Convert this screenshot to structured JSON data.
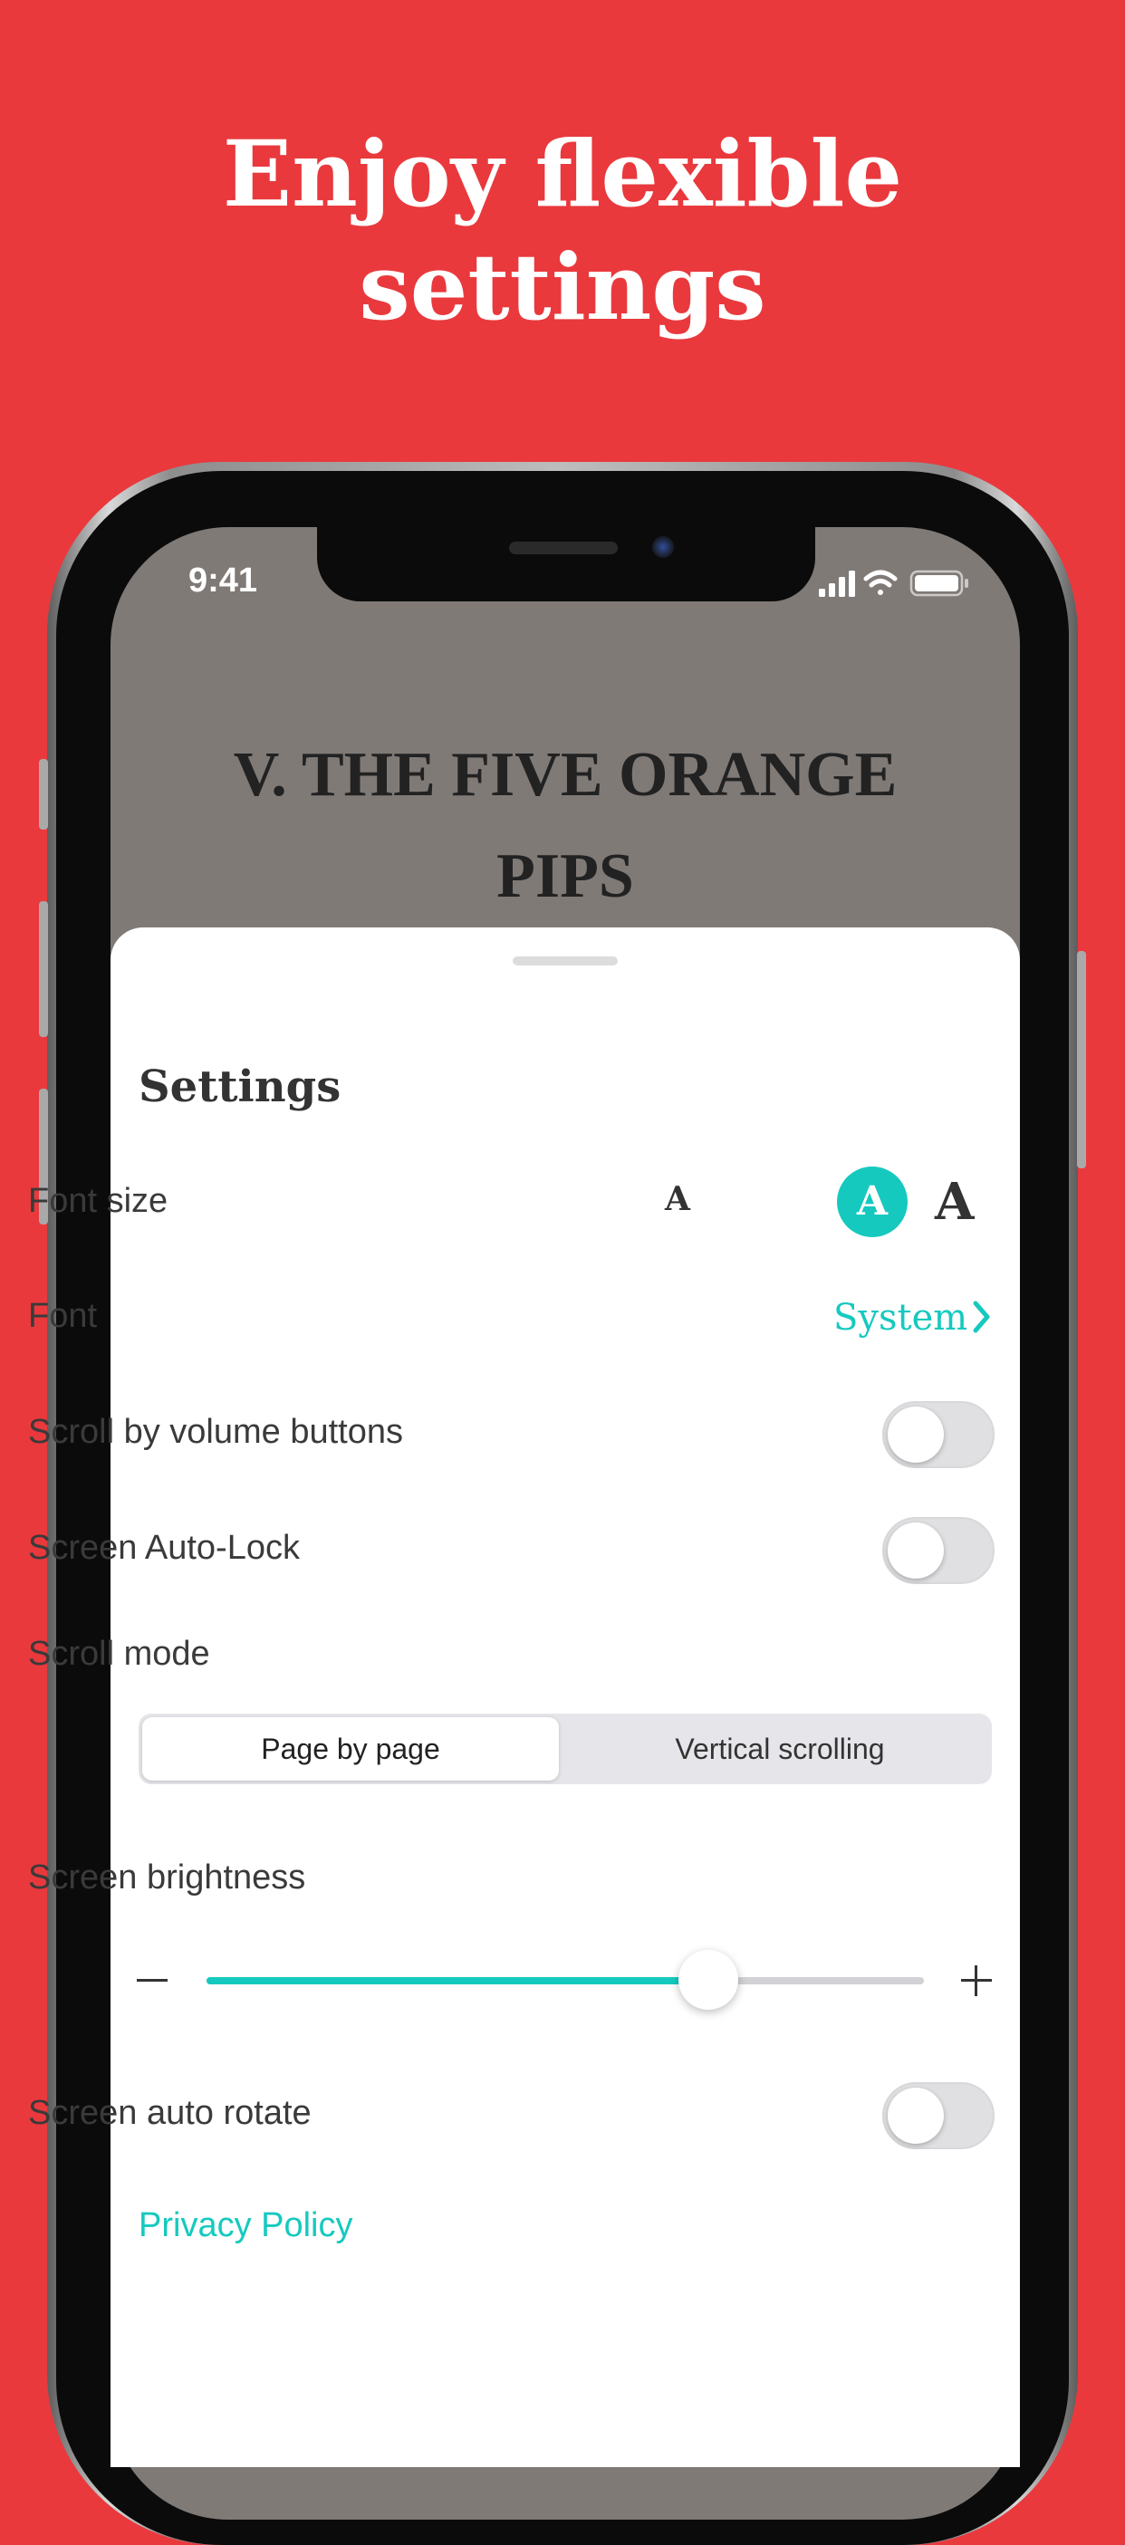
{
  "promo": {
    "headline_line1": "Enjoy flexible",
    "headline_line2": "settings"
  },
  "status_bar": {
    "time": "9:41",
    "icons": [
      "signal-icon",
      "wifi-icon",
      "battery-icon"
    ]
  },
  "book": {
    "title_line1": "V. THE FIVE ORANGE",
    "title_line2": "PIPS"
  },
  "settings": {
    "title": "Settings",
    "font_size": {
      "label": "Font size",
      "options": [
        "A",
        "A",
        "A"
      ],
      "selected_index": 1
    },
    "font": {
      "label": "Font",
      "value": "System"
    },
    "scroll_by_volume": {
      "label": "Scroll by volume buttons",
      "on": false
    },
    "auto_lock": {
      "label": "Screen Auto-Lock",
      "on": false
    },
    "scroll_mode": {
      "label": "Scroll mode",
      "options": [
        "Page by page",
        "Vertical scrolling"
      ],
      "selected": "Page by page"
    },
    "brightness": {
      "label": "Screen brightness",
      "value": 0.7
    },
    "auto_rotate": {
      "label": "Screen auto rotate",
      "on": false
    },
    "privacy_policy": "Privacy Policy"
  },
  "colors": {
    "background": "#e9393d",
    "accent": "#16c9bf",
    "book_bg": "#807a77"
  }
}
